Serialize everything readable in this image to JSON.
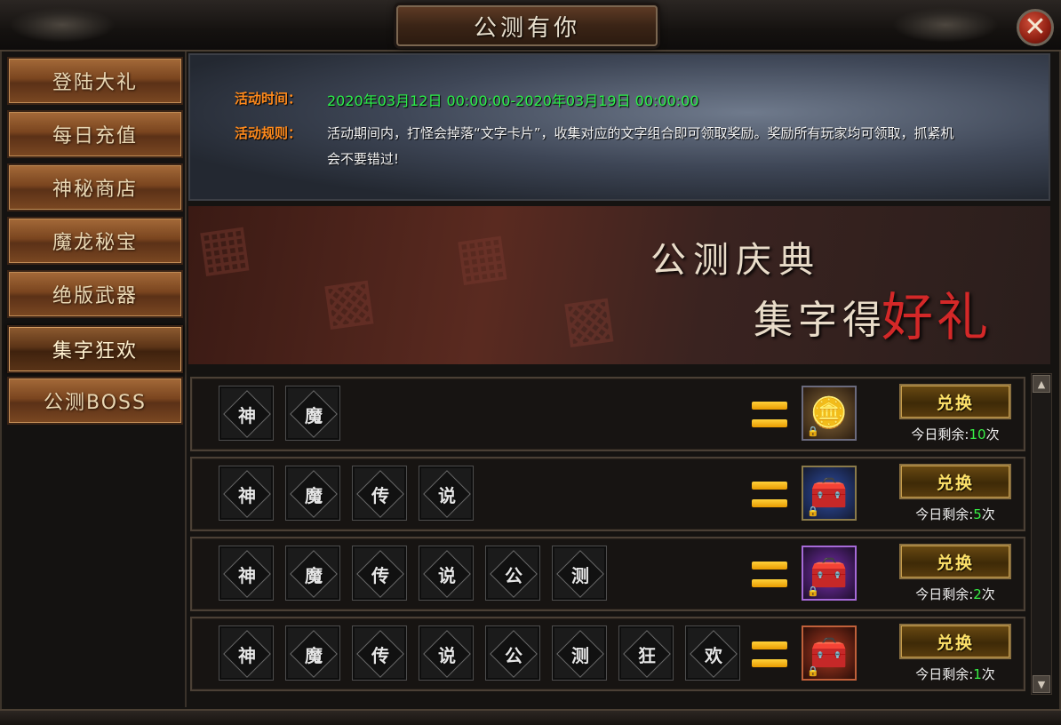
{
  "window": {
    "title": "公测有你",
    "close": "✕"
  },
  "sidebar": {
    "items": [
      {
        "label": "登陆大礼"
      },
      {
        "label": "每日充值"
      },
      {
        "label": "神秘商店"
      },
      {
        "label": "魔龙秘宝"
      },
      {
        "label": "绝版武器"
      },
      {
        "label": "集字狂欢",
        "active": true
      },
      {
        "label": "公测BOSS"
      }
    ]
  },
  "info": {
    "time_label": "活动时间：",
    "time_value": "2020年03月12日 00:00:00-2020年03月19日 00:00:00",
    "rule_label": "活动规则：",
    "rule_text": "活动期间内，打怪会掉落“文字卡片”，收集对应的文字组合即可领取奖励。奖励所有玩家均可领取，抓紧机会不要错过!"
  },
  "banner": {
    "line1": "公测庆典",
    "line2": "集字得",
    "line3": "好礼"
  },
  "rewards": [
    {
      "chars": [
        "神",
        "魔"
      ],
      "chest_color": "#8a6a3a",
      "chest_icon": "gold-treasure-chest-icon",
      "button": "兑换",
      "remain_prefix": "今日剩余:",
      "remain_count": "10",
      "remain_suffix": "次"
    },
    {
      "chars": [
        "神",
        "魔",
        "传",
        "说"
      ],
      "chest_color": "#2f4fa8",
      "chest_icon": "blue-treasure-chest-icon",
      "button": "兑换",
      "remain_prefix": "今日剩余:",
      "remain_count": "5",
      "remain_suffix": "次"
    },
    {
      "chars": [
        "神",
        "魔",
        "传",
        "说",
        "公",
        "测"
      ],
      "chest_color": "#7a2fb0",
      "chest_icon": "purple-treasure-chest-icon",
      "button": "兑换",
      "remain_prefix": "今日剩余:",
      "remain_count": "2",
      "remain_suffix": "次"
    },
    {
      "chars": [
        "神",
        "魔",
        "传",
        "说",
        "公",
        "测",
        "狂",
        "欢"
      ],
      "chest_color": "#b03a22",
      "chest_icon": "red-treasure-chest-icon",
      "button": "兑换",
      "remain_prefix": "今日剩余:",
      "remain_count": "1",
      "remain_suffix": "次"
    }
  ],
  "scrollbar": {
    "up": "▲",
    "down": "▼"
  }
}
